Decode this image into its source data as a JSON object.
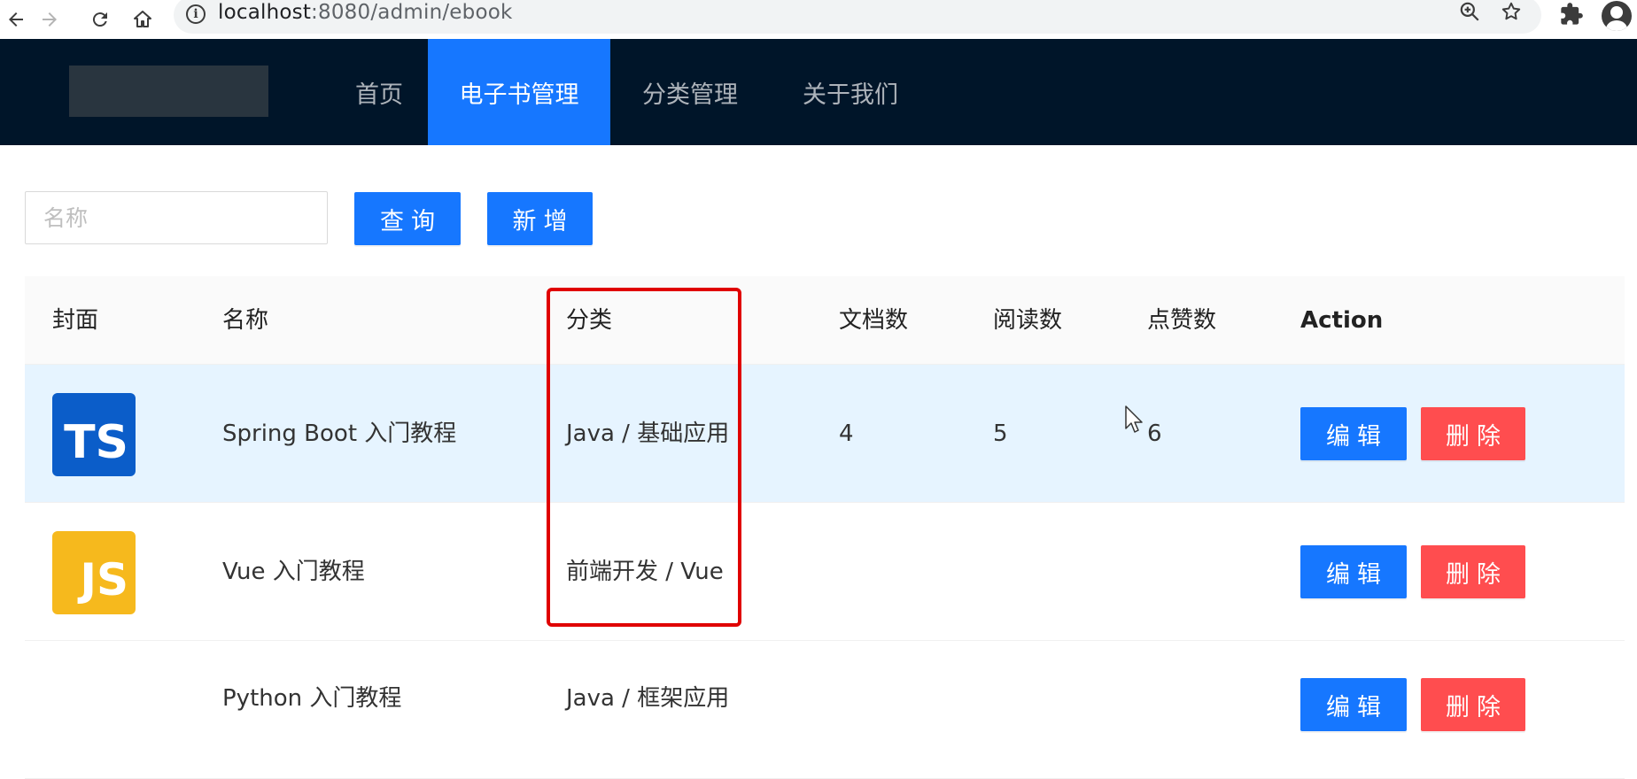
{
  "browser": {
    "url_host": "localhost",
    "url_rest": ":8080/admin/ebook",
    "info_glyph": "i"
  },
  "header": {
    "menu": [
      {
        "label": "首页",
        "active": false
      },
      {
        "label": "电子书管理",
        "active": true
      },
      {
        "label": "分类管理",
        "active": false
      },
      {
        "label": "关于我们",
        "active": false
      }
    ]
  },
  "toolbar": {
    "search_placeholder": "名称",
    "query_label": "查询",
    "add_label": "新增"
  },
  "table": {
    "columns": [
      "封面",
      "名称",
      "分类",
      "文档数",
      "阅读数",
      "点赞数",
      "Action"
    ],
    "rows": [
      {
        "cover": "TS",
        "name": "Spring Boot 入门教程",
        "category": "Java / 基础应用",
        "doc_count": "4",
        "view_count": "5",
        "vote_count": "6",
        "edit_label": "编辑",
        "delete_label": "删除"
      },
      {
        "cover": "JS",
        "name": "Vue 入门教程",
        "category": "前端开发 / Vue",
        "doc_count": "",
        "view_count": "",
        "vote_count": "",
        "edit_label": "编辑",
        "delete_label": "删除"
      }
    ],
    "third_row_partial": {
      "name": "Python 入门教程",
      "category": "Java / 框架应用",
      "edit_label": "编辑",
      "delete_label": "删除"
    }
  },
  "colors": {
    "header_bg": "#001529",
    "primary": "#1677ff",
    "danger": "#ff4d4f",
    "row_hover": "#e6f4ff",
    "highlight": "#e00000"
  }
}
